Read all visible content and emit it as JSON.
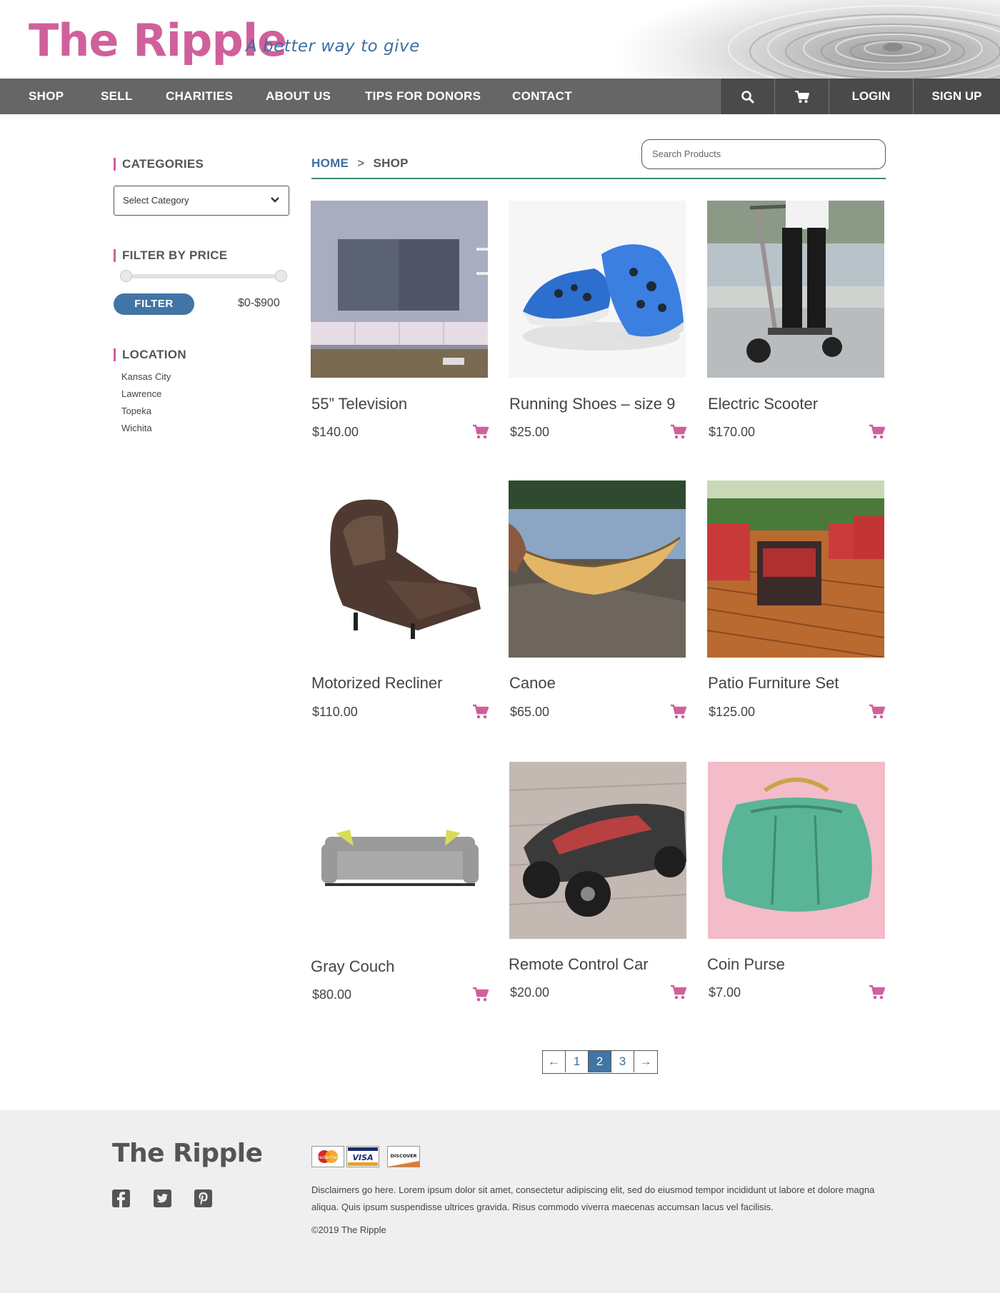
{
  "site": {
    "logo": "The Ripple",
    "tagline": "A better way to give"
  },
  "nav": {
    "items": [
      "SHOP",
      "SELL",
      "CHARITIES",
      "ABOUT US",
      "TIPS FOR DONORS",
      "CONTACT"
    ],
    "login": "LOGIN",
    "signup": "SIGN UP",
    "search_icon": "search-icon",
    "cart_icon": "cart-icon"
  },
  "sidebar": {
    "categories_heading": "CATEGORIES",
    "category_select": "Select Category",
    "filter_heading": "FILTER BY PRICE",
    "filter_button": "FILTER",
    "price_range": "$0-$900",
    "location_heading": "LOCATION",
    "locations": [
      "Kansas City",
      "Lawrence",
      "Topeka",
      "Wichita"
    ]
  },
  "breadcrumb": {
    "home": "HOME",
    "separator": ">",
    "current": "SHOP"
  },
  "search": {
    "placeholder": "Search Products"
  },
  "products": [
    {
      "title": "55” Television",
      "price": "$140.00"
    },
    {
      "title": "Running Shoes – size 9",
      "price": "$25.00"
    },
    {
      "title": "Electric Scooter",
      "price": "$170.00"
    },
    {
      "title": "Motorized Recliner",
      "price": "$110.00"
    },
    {
      "title": "Canoe",
      "price": "$65.00"
    },
    {
      "title": "Patio Furniture Set",
      "price": "$125.00"
    },
    {
      "title": "Gray Couch",
      "price": "$80.00"
    },
    {
      "title": "Remote Control Car",
      "price": "$20.00"
    },
    {
      "title": "Coin Purse",
      "price": "$7.00"
    }
  ],
  "pagination": {
    "prev": "←",
    "pages": [
      "1",
      "2",
      "3"
    ],
    "current": "2",
    "next": "→"
  },
  "footer": {
    "logo": "The Ripple",
    "payment": [
      "MasterCard",
      "VISA",
      "DISCOVER"
    ],
    "disclaimer": "Disclaimers go here. Lorem ipsum dolor sit amet, consectetur adipiscing elit, sed do eiusmod tempor incididunt ut labore et dolore magna aliqua. Quis ipsum suspendisse ultrices gravida. Risus commodo viverra maecenas accumsan lacus vel facilisis.",
    "copyright": "©2019 The Ripple",
    "social_icons": [
      "facebook-icon",
      "twitter-icon",
      "pinterest-icon"
    ]
  },
  "colors": {
    "brand_pink": "#d0609c",
    "brand_blue": "#4274a5",
    "nav_gray": "#666666",
    "accent_teal": "#3d8a7a"
  }
}
